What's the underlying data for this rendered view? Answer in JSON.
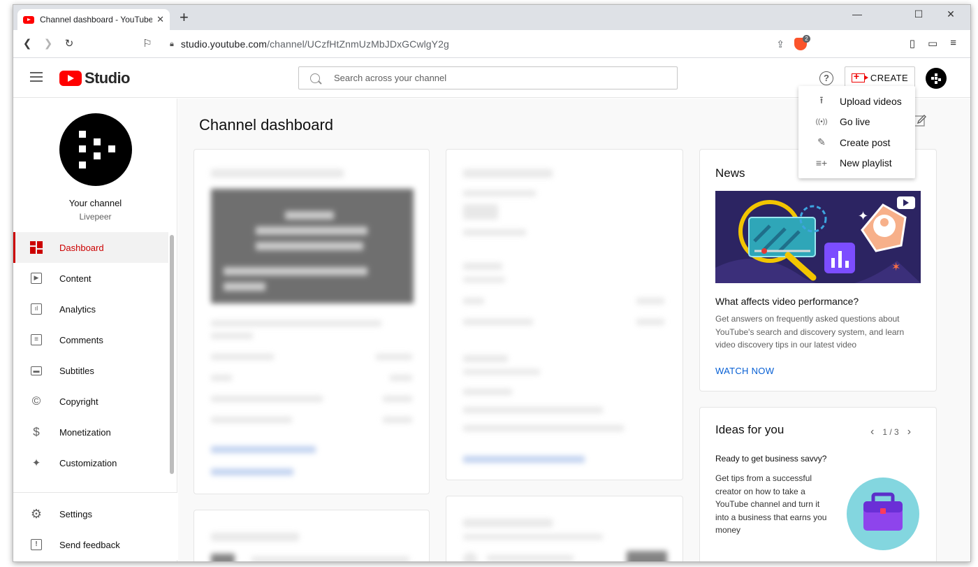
{
  "browser": {
    "tab_title": "Channel dashboard - YouTube Studio",
    "tab_close": "✕",
    "new_tab": "+",
    "url_host": "studio.youtube.com",
    "url_path": "/channel/UCzfHtZnmUzMbJDxGCwlgY2g",
    "brave_badge": "2",
    "win_minimize": "—",
    "win_maximize": "☐",
    "win_close": "✕"
  },
  "header": {
    "logo_text": "Studio",
    "search_placeholder": "Search across your channel",
    "help": "?",
    "create_label": "CREATE"
  },
  "create_menu": [
    {
      "label": "Upload videos",
      "icon": "upload-icon",
      "glyph": "⭱"
    },
    {
      "label": "Go live",
      "icon": "live-icon",
      "glyph": "((•))"
    },
    {
      "label": "Create post",
      "icon": "create-post-icon",
      "glyph": "✎"
    },
    {
      "label": "New playlist",
      "icon": "new-playlist-icon",
      "glyph": "≡+"
    }
  ],
  "sidebar": {
    "channel_label": "Your channel",
    "channel_name": "Livepeer",
    "items": [
      {
        "label": "Dashboard",
        "icon": "dashboard-icon",
        "glyph": "▦",
        "active": true
      },
      {
        "label": "Content",
        "icon": "content-icon",
        "glyph": "▷"
      },
      {
        "label": "Analytics",
        "icon": "analytics-icon",
        "glyph": "▮"
      },
      {
        "label": "Comments",
        "icon": "comments-icon",
        "glyph": "☰"
      },
      {
        "label": "Subtitles",
        "icon": "subtitles-icon",
        "glyph": "▤"
      },
      {
        "label": "Copyright",
        "icon": "copyright-icon",
        "glyph": "©"
      },
      {
        "label": "Monetization",
        "icon": "monetization-icon",
        "glyph": "$"
      },
      {
        "label": "Customization",
        "icon": "customization-icon",
        "glyph": "✦"
      }
    ],
    "bottom": [
      {
        "label": "Settings",
        "icon": "settings-icon",
        "glyph": "⚙"
      },
      {
        "label": "Send feedback",
        "icon": "feedback-icon",
        "glyph": "!"
      }
    ]
  },
  "main": {
    "page_title": "Channel dashboard",
    "news": {
      "heading": "News",
      "title": "What affects video performance?",
      "description": "Get answers on frequently asked questions about YouTube's search and discovery system, and learn video discovery tips in our latest video",
      "link": "WATCH NOW"
    },
    "ideas": {
      "heading": "Ideas for you",
      "pager": "1 / 3",
      "subtitle": "Ready to get business savvy?",
      "description": "Get tips from a successful creator on how to take a YouTube channel and turn it into a business that earns you money"
    }
  },
  "colors": {
    "brand_red": "#ff0000",
    "active_red": "#cc0000",
    "link_blue": "#065fd4",
    "news_bg": "#2c2462",
    "ideas_circle": "#83d6df"
  }
}
